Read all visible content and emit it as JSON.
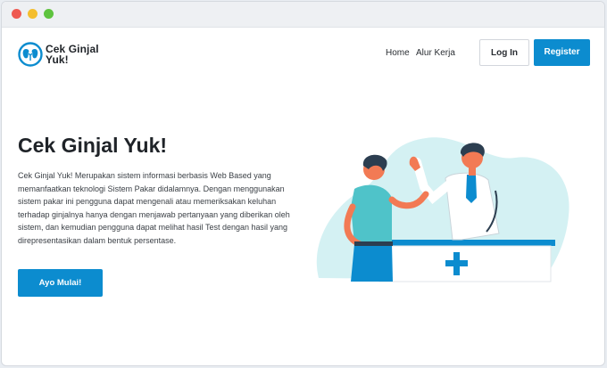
{
  "window": {
    "controls": [
      "close",
      "minimize",
      "maximize"
    ]
  },
  "header": {
    "logo_text": "Cek Ginjal\nYuk!",
    "logo_icon": "kidney-icon",
    "nav": [
      {
        "label": "Home"
      },
      {
        "label": "Alur Kerja"
      }
    ],
    "login_label": "Log In",
    "register_label": "Register"
  },
  "hero": {
    "title": "Cek Ginjal Yuk!",
    "description": "Cek Ginjal Yuk! Merupakan sistem informasi berbasis Web Based yang memanfaatkan teknologi Sistem Pakar didalamnya. Dengan menggunakan sistem pakar ini pengguna dapat mengenali atau memeriksakan keluhan terhadap ginjalnya hanya dengan menjawab pertanyaan yang diberikan oleh sistem, dan kemudian pengguna dapat melihat hasil Test dengan hasil yang direpresentasikan dalam bentuk persentase.",
    "cta_label": "Ayo Mulai!",
    "illustration": "doctor-consultation-illustration"
  },
  "colors": {
    "primary": "#0c8ccf",
    "accent_bg": "#d4f1f3",
    "text_dark": "#1f2328"
  }
}
